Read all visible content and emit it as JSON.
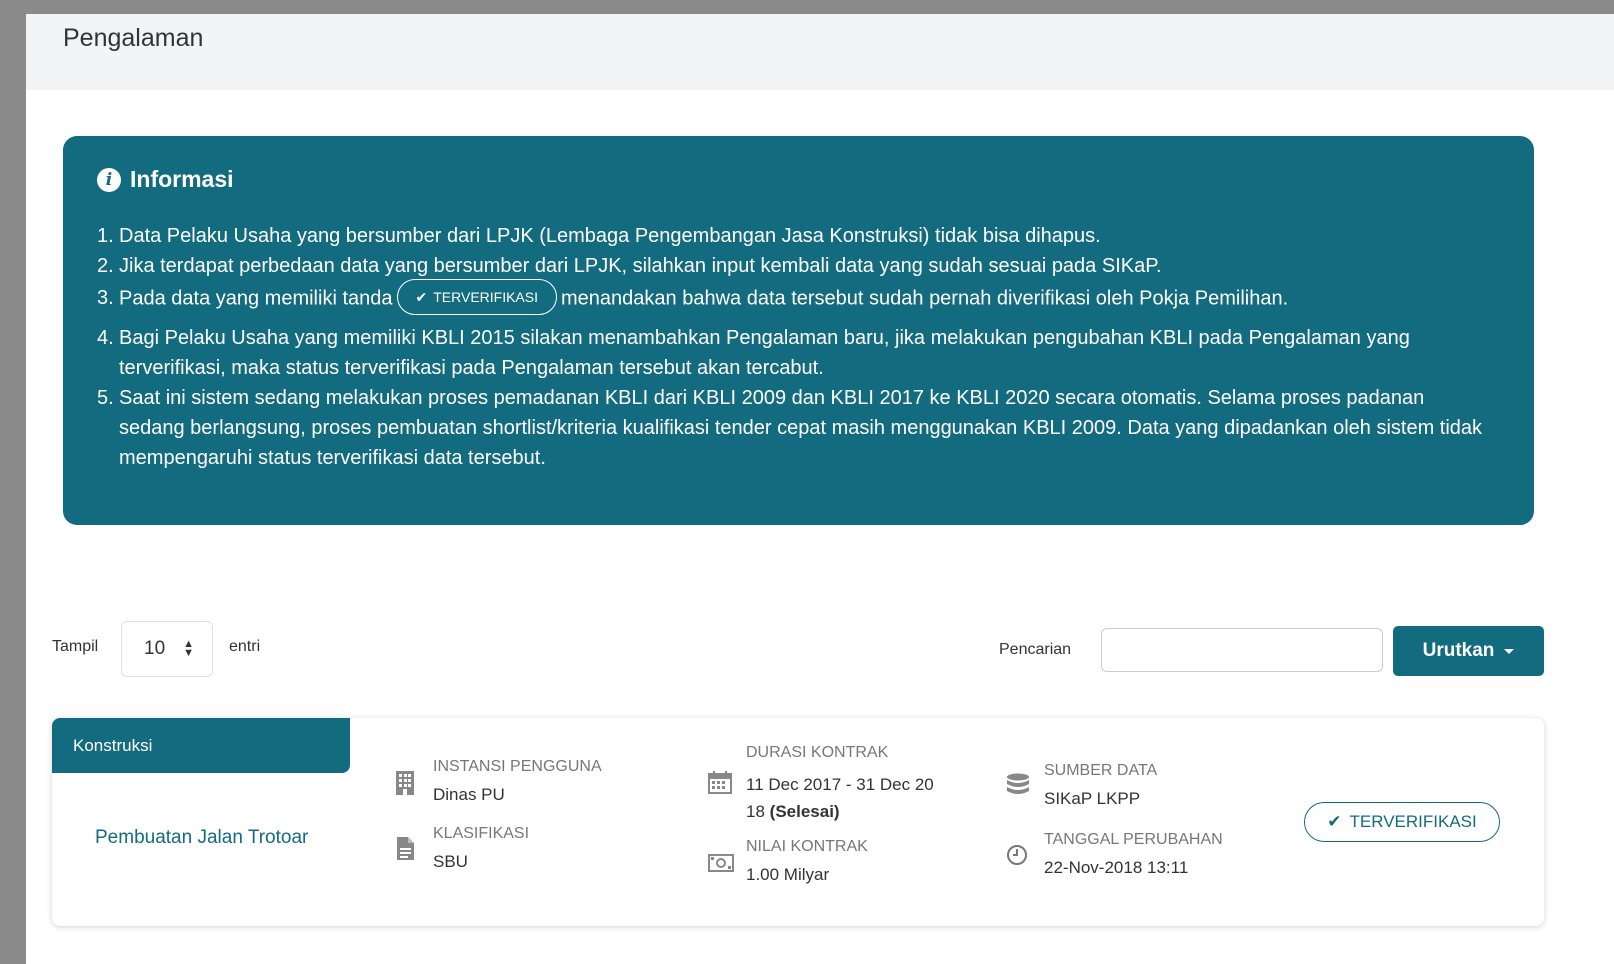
{
  "page": {
    "title": "Pengalaman"
  },
  "info": {
    "title": "Informasi",
    "items": [
      {
        "num": "1.",
        "text": "Data Pelaku Usaha yang bersumber dari LPJK (Lembaga Pengembangan Jasa Konstruksi) tidak bisa dihapus."
      },
      {
        "num": "2.",
        "text": "Jika terdapat perbedaan data yang bersumber dari LPJK, silahkan input kembali data yang sudah sesuai pada SIKaP."
      },
      {
        "num": "3.",
        "text_before": "Pada data yang memiliki tanda",
        "badge": "TERVERIFIKASI",
        "text_after": "menandakan bahwa data tersebut sudah pernah diverifikasi oleh Pokja Pemilihan."
      },
      {
        "num": "4.",
        "text": "Bagi Pelaku Usaha yang memiliki KBLI 2015 silakan menambahkan Pengalaman baru, jika melakukan pengubahan KBLI pada Pengalaman yang terverifikasi, maka status terverifikasi pada Pengalaman tersebut akan tercabut."
      },
      {
        "num": "5.",
        "text": "Saat ini sistem sedang melakukan proses pemadanan KBLI dari KBLI 2009 dan KBLI 2017 ke KBLI 2020 secara otomatis. Selama proses padanan sedang berlangsung, proses pembuatan shortlist/kriteria kualifikasi tender cepat masih menggunakan KBLI 2009. Data yang dipadankan oleh sistem tidak mempengaruhi status terverifikasi data tersebut."
      }
    ]
  },
  "controls": {
    "show_label": "Tampil",
    "show_value": "10",
    "entries_label": "entri",
    "search_label": "Pencarian",
    "search_value": "",
    "sort_label": "Urutkan"
  },
  "record": {
    "category": "Konstruksi",
    "name": "Pembuatan Jalan Trotoar",
    "instansi_label": "INSTANSI PENGGUNA",
    "instansi_value": "Dinas PU",
    "klasifikasi_label": "KLASIFIKASI",
    "klasifikasi_value": "SBU",
    "durasi_label": "DURASI KONTRAK",
    "durasi_line1": "11 Dec 2017 - 31 Dec 20",
    "durasi_line2a": "18",
    "durasi_status": "(Selesai)",
    "nilai_label": "NILAI KONTRAK",
    "nilai_value": "1.00 Milyar",
    "sumber_label": "SUMBER DATA",
    "sumber_value": "SIKaP LKPP",
    "tanggal_label": "TANGGAL PERUBAHAN",
    "tanggal_value": "22-Nov-2018 13:11",
    "status_label": "TERVERIFIKASI"
  },
  "colors": {
    "primary": "#136b80",
    "header_bg": "#f3f4f6"
  },
  "icons": [
    "info-icon",
    "check-icon",
    "sort-arrows-icon",
    "caret-down-icon",
    "building-icon",
    "document-icon",
    "calendar-icon",
    "money-icon",
    "database-icon",
    "clock-icon"
  ]
}
